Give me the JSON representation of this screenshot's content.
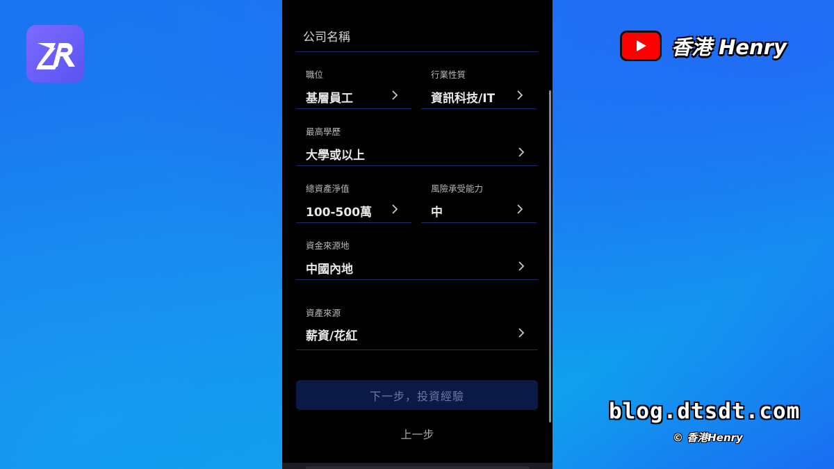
{
  "overlay": {
    "channel": "香港 Henry",
    "site": "blog.dtsdt.com",
    "copyright": "© 香港Henry"
  },
  "form": {
    "company_name_placeholder": "公司名稱",
    "fields": {
      "position": {
        "label": "職位",
        "value": "基層員工"
      },
      "industry": {
        "label": "行業性質",
        "value": "資訊科技/IT"
      },
      "education": {
        "label": "最高學歷",
        "value": "大學或以上"
      },
      "net_worth": {
        "label": "總資產淨值",
        "value": "100-500萬"
      },
      "risk": {
        "label": "風險承受能力",
        "value": "中"
      },
      "fund_source": {
        "label": "資金來源地",
        "value": "中國內地"
      },
      "asset_source": {
        "label": "資產來源",
        "value": "薪資/花紅"
      }
    },
    "next_button": "下一步，投資經驗",
    "prev_button": "上一步"
  },
  "colors": {
    "background_blue": "#1a73f0",
    "logo_purple": "#6a5ff8",
    "youtube_red": "#ff0000",
    "phone_bg": "#000000",
    "divider": "#1e2a6b",
    "next_button_bg": "#0a1a45"
  },
  "icons": {
    "chevron": "chevron-right-icon",
    "app": "zr-logo",
    "youtube": "youtube-icon"
  }
}
